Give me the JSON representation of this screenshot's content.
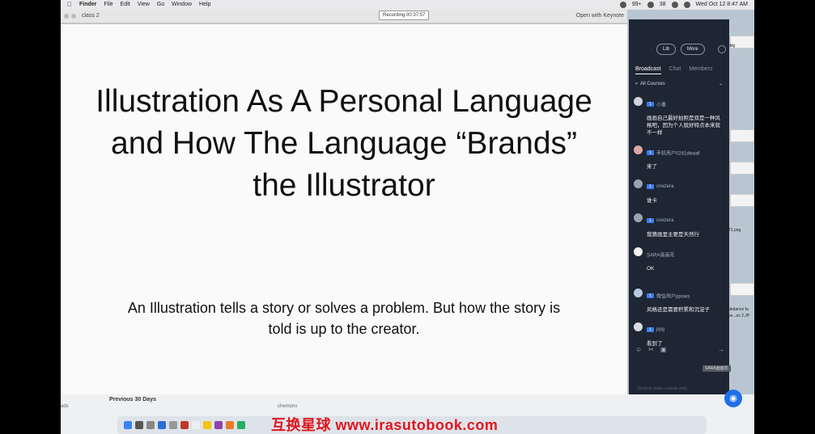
{
  "menubar": {
    "app_name": "Finder",
    "items": [
      "File",
      "Edit",
      "View",
      "Go",
      "Window",
      "Help"
    ],
    "status_items": [
      "99+",
      "38"
    ],
    "datetime": "Wed Oct 12  8:47 AM"
  },
  "recording": "Recording 00:37:57",
  "keynote": {
    "window_title": "class 2",
    "open_with": "Open with Keynote",
    "slide_title": "Illustration As A Personal Language and How The Language “Brands” the Illustrator",
    "slide_body": "An Illustration tells a story or solves a problem. But how the story is told is up to the creator."
  },
  "panel": {
    "lib_label": "Lib",
    "more_label": "More",
    "tabs": [
      "Broadcast",
      "Chat",
      "Members"
    ],
    "filter": "All Courses",
    "messages": [
      {
        "badge": "1",
        "name": "小董",
        "text": "画画自己最好拍照是双是一种风格吧，因为个人就好特点本来就不一样"
      },
      {
        "badge": "1",
        "name": "手机用户0241dwaaf",
        "text": "来了"
      },
      {
        "badge": "1",
        "name": "cnezera",
        "text": "谁卡"
      },
      {
        "badge": "1",
        "name": "cnezera",
        "text": "我猜画里主要是天然行"
      },
      {
        "badge": "",
        "name": "SARA画画花",
        "text": "OK"
      },
      {
        "badge": "1",
        "name": "微信用户ppows",
        "text": "风格还是需要积累和沉淀子"
      },
      {
        "badge": "1",
        "name": "ppg",
        "text": "看到了"
      }
    ],
    "send_note": "Send to main course only",
    "user_tag": "SARA画画花"
  },
  "finder": {
    "previous_label": "Previous 30 Days",
    "sidebar_text": "ads",
    "file_text": "chemons"
  },
  "desktop": {
    "labels": [
      "ddg",
      "dedance fa",
      "ve...es 2.JP",
      "71.png"
    ]
  },
  "watermark": "互换星球 www.irasutobook.com"
}
